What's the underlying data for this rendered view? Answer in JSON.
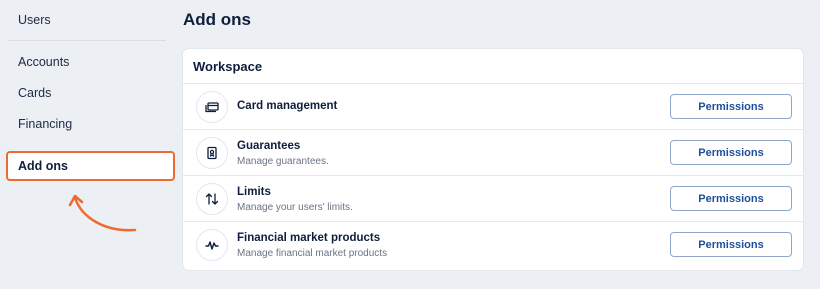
{
  "sidebar": {
    "items": [
      {
        "label": "Users"
      },
      {
        "label": "Accounts"
      },
      {
        "label": "Cards"
      },
      {
        "label": "Financing"
      },
      {
        "label": "Add ons"
      }
    ]
  },
  "page": {
    "title": "Add ons"
  },
  "section": {
    "title": "Workspace",
    "rows": [
      {
        "title": "Card management",
        "description": "",
        "icon": "cards-icon",
        "button": "Permissions"
      },
      {
        "title": "Guarantees",
        "description": "Manage guarantees.",
        "icon": "guarantee-badge-icon",
        "button": "Permissions"
      },
      {
        "title": "Limits",
        "description": "Manage your users' limits.",
        "icon": "up-down-arrows-icon",
        "button": "Permissions"
      },
      {
        "title": "Financial market products",
        "description": "Manage financial market products",
        "icon": "market-pulse-icon",
        "button": "Permissions"
      }
    ]
  },
  "colors": {
    "highlight": "#ee6a2f",
    "accent": "#1f4f9a"
  }
}
